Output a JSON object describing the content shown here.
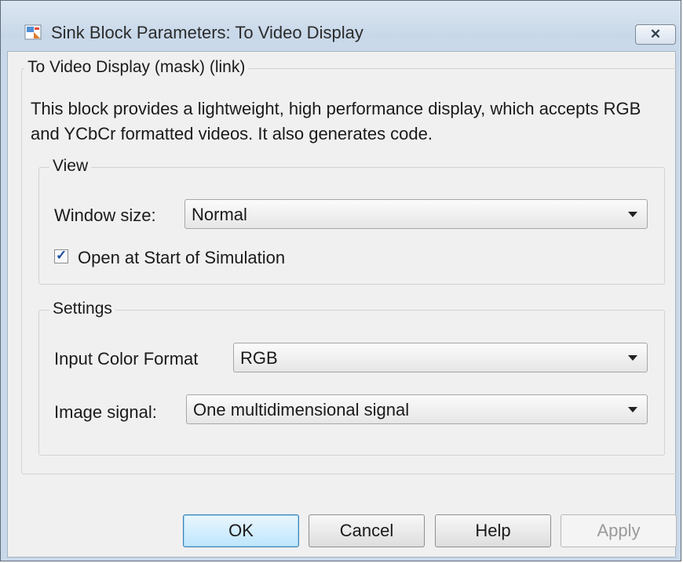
{
  "window": {
    "title": "Sink Block Parameters: To Video Display",
    "close_glyph": "✕",
    "icon": "simulink-block-icon"
  },
  "mask": {
    "legend": "To Video Display (mask) (link)",
    "description": "This block provides a lightweight, high performance display, which accepts RGB and YCbCr formatted videos. It also generates code."
  },
  "view": {
    "legend": "View",
    "window_size_label": "Window size:",
    "window_size_value": "Normal",
    "open_at_start_label": "Open at Start of Simulation",
    "open_at_start_checked": true
  },
  "settings": {
    "legend": "Settings",
    "input_color_format_label": "Input Color Format",
    "input_color_format_value": "RGB",
    "image_signal_label": "Image signal:",
    "image_signal_value": "One multidimensional signal"
  },
  "buttons": {
    "ok": "OK",
    "cancel": "Cancel",
    "help": "Help",
    "apply": "Apply"
  }
}
